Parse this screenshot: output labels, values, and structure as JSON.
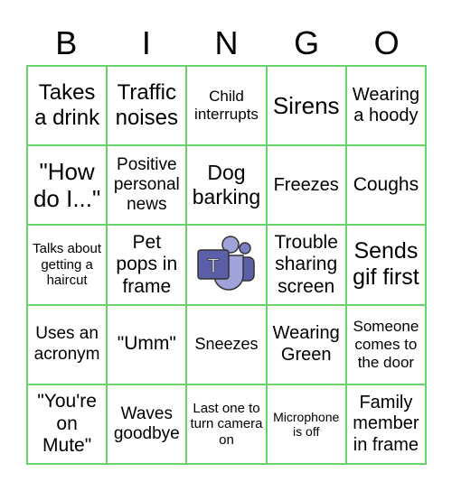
{
  "header": [
    "B",
    "I",
    "N",
    "G",
    "O"
  ],
  "cells": [
    "Takes a drink",
    "Traffic noises",
    "Child interrupts",
    "Sirens",
    "Wearing a hoody",
    "\"How do I...\"",
    "Positive personal news",
    "Dog barking",
    "Freezes",
    "Coughs",
    "Talks about getting a haircut",
    "Pet pops in frame",
    "",
    "Trouble sharing screen",
    "Sends gif first",
    "Uses an acronym",
    "\"Umm\"",
    "Sneezes",
    "Wearing Green",
    "Someone comes to the door",
    "\"You're on Mute\"",
    "Waves goodbye",
    "Last one to turn camera on",
    "Microphone is off",
    "Family member in frame"
  ],
  "free_space": {
    "icon": "microsoft-teams-logo-icon",
    "logo_letter": "T"
  },
  "colors": {
    "grid": "#66d466",
    "teams_dark": "#5b5fa7",
    "teams_light": "#9fa3d9"
  }
}
